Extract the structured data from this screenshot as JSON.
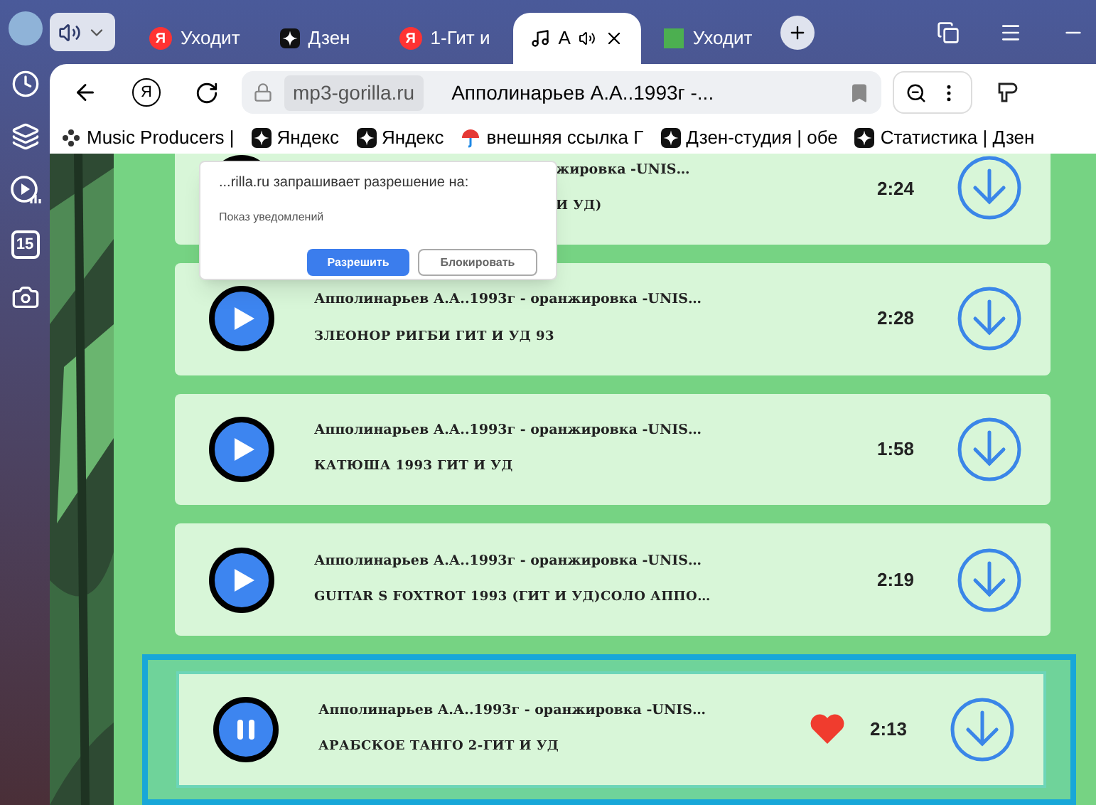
{
  "tabs": [
    {
      "label": "Уходит",
      "kind": "yandex",
      "logo": "Я",
      "selected": false,
      "audio": false
    },
    {
      "label": "Дзен",
      "kind": "zen",
      "selected": false,
      "audio": false
    },
    {
      "label": "1-Гит и",
      "kind": "yandex",
      "logo": "Я",
      "selected": false,
      "audio": false
    },
    {
      "label": "А",
      "kind": "music",
      "selected": true,
      "audio": true
    },
    {
      "label": "Уходит",
      "kind": "square",
      "selected": false,
      "audio": false
    }
  ],
  "address": {
    "home_logo": "Я",
    "domain": "mp3-gorilla.ru",
    "title": "Апполинарьев А.А..1993г -..."
  },
  "bookmarks": [
    {
      "label": "Music Producers |",
      "kind": "dots"
    },
    {
      "label": "Яндекс",
      "kind": "zen"
    },
    {
      "label": "Яндекс",
      "kind": "zen"
    },
    {
      "label": "внешняя ссылка Г",
      "kind": "umbrella"
    },
    {
      "label": "Дзен-студия | обе",
      "kind": "zen"
    },
    {
      "label": "Статистика | Дзен",
      "kind": "zen"
    }
  ],
  "sidebar": {
    "calendar_day": "15"
  },
  "popup": {
    "message": "...rilla.ru запрашивает разрешение на:",
    "detail": "Показ уведомлений",
    "buttons": [
      {
        "label": "Разрешить",
        "kind": "primary"
      },
      {
        "label": "Блокировать",
        "kind": "secondary"
      }
    ]
  },
  "tracks": [
    {
      "artist": "жировка -UNIS…",
      "title": "И УД)",
      "duration": "2:24",
      "playing": false,
      "liked": false,
      "covered": true
    },
    {
      "artist": "Апполинарьев А.А..1993г - оранжировка -UNIS…",
      "title": "ЗЛЕОНОР РИГБИ ГИТ И УД 93",
      "duration": "2:28",
      "playing": false,
      "liked": false,
      "covered": false
    },
    {
      "artist": "Апполинарьев А.А..1993г - оранжировка -UNIS…",
      "title": "КАТЮША 1993 ГИТ И УД",
      "duration": "1:58",
      "playing": false,
      "liked": false,
      "covered": false
    },
    {
      "artist": "Апполинарьев А.А..1993г - оранжировка -UNIS…",
      "title": "GUITAR S FOXTROT 1993 (ГИТ И УД)СОЛО АППО…",
      "duration": "2:19",
      "playing": false,
      "liked": false,
      "covered": false
    },
    {
      "artist": "Апполинарьев А.А..1993г - оранжировка -UNIS…",
      "title": "АРАБСКОЕ ТАНГО 2-ГИТ И УД",
      "duration": "2:13",
      "playing": true,
      "liked": true,
      "covered": false
    }
  ]
}
